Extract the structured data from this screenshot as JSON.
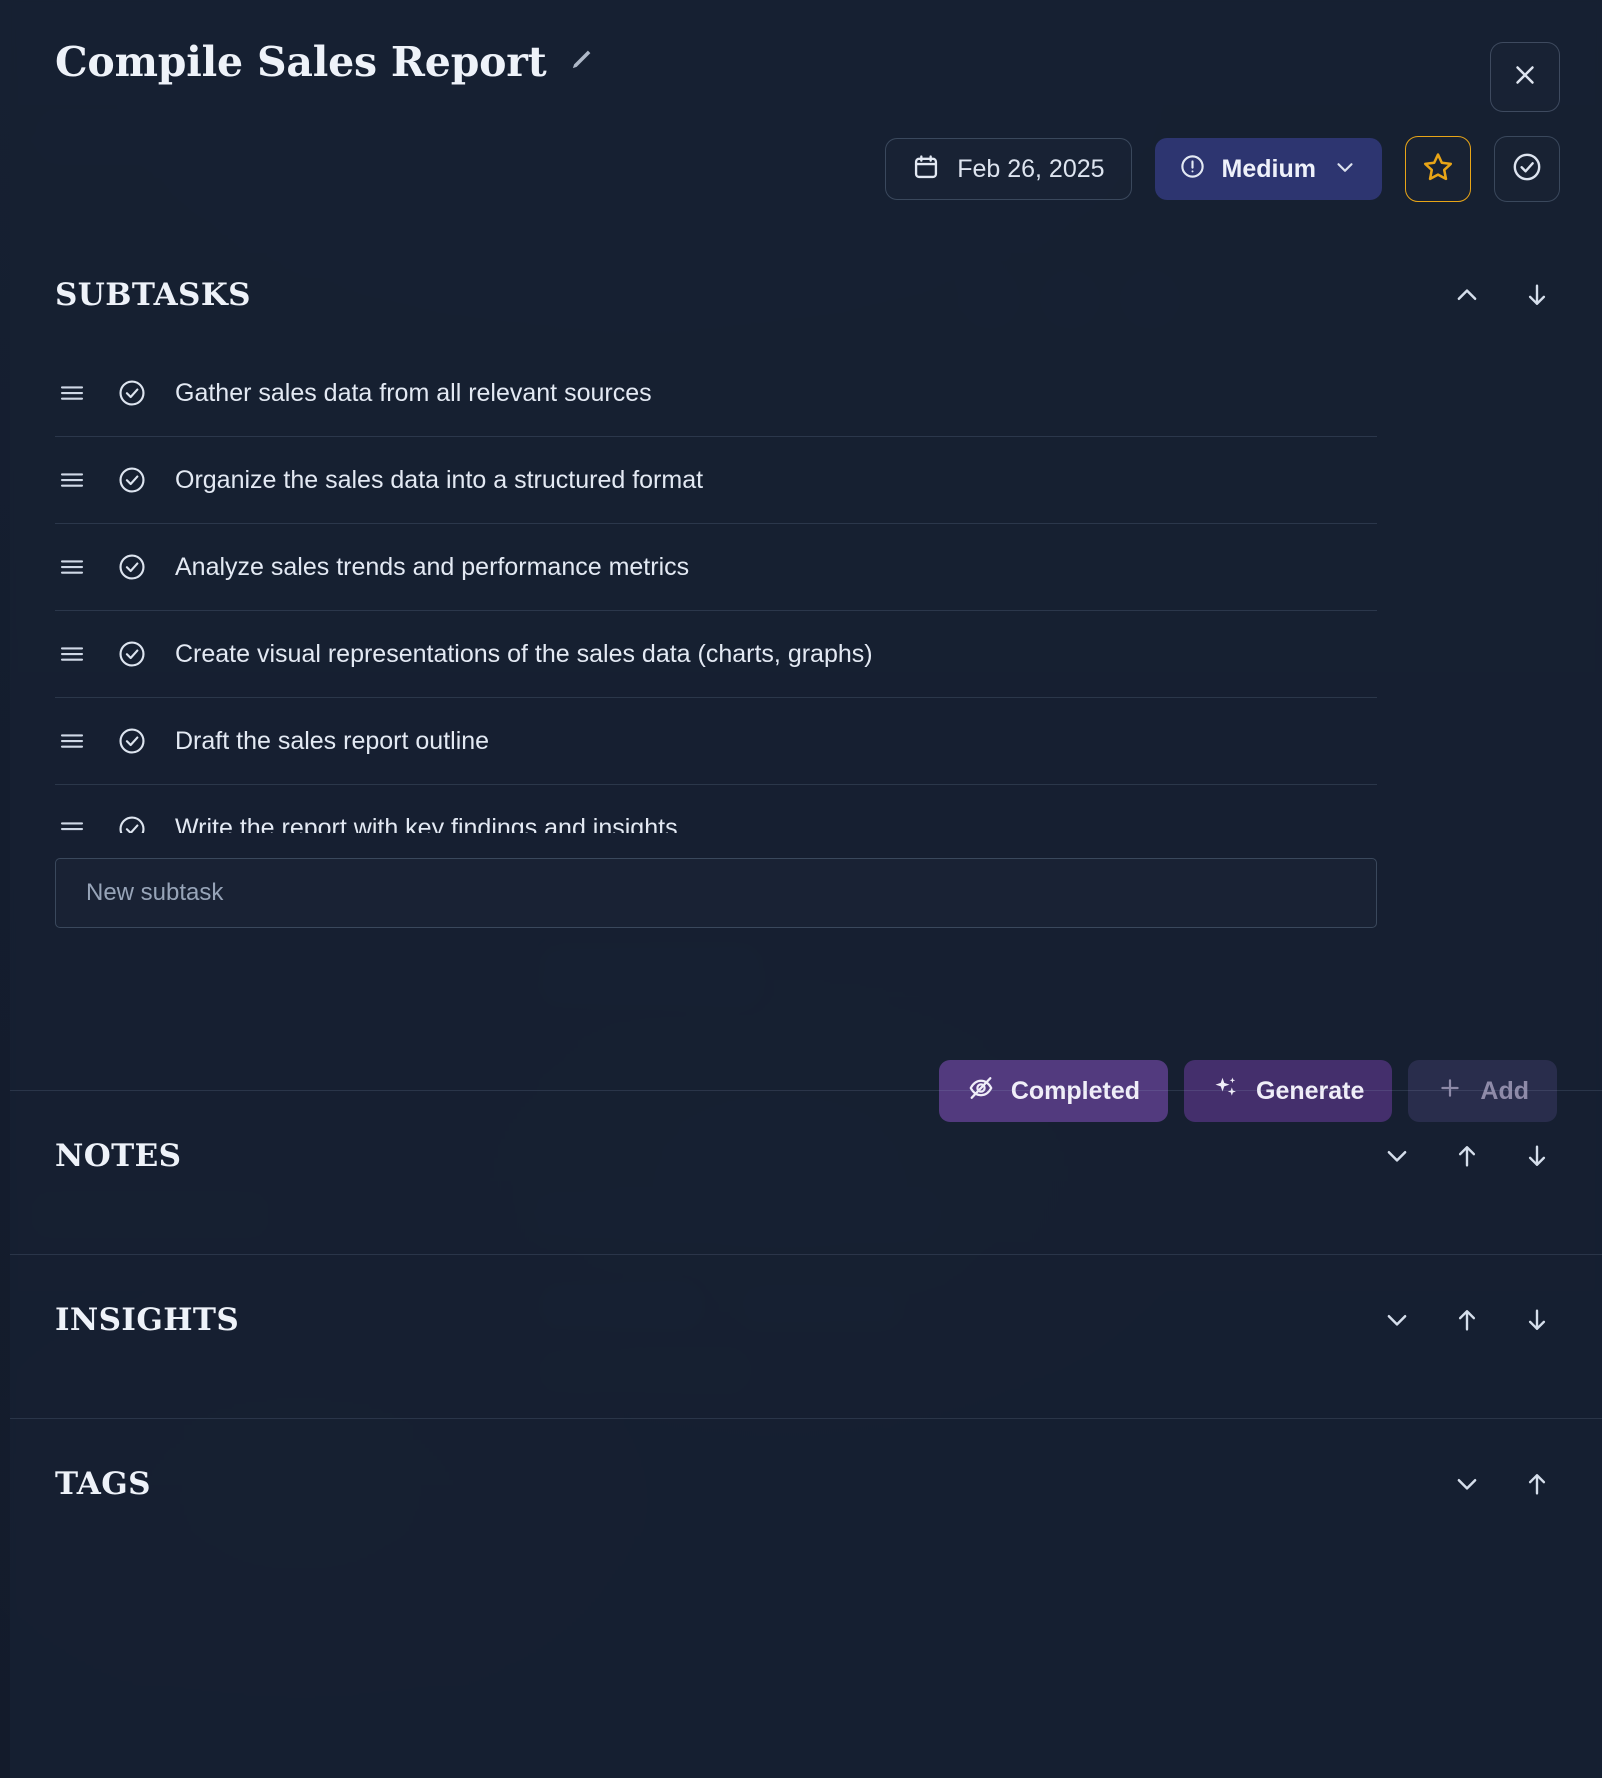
{
  "header": {
    "title": "Compile Sales Report",
    "edit_icon": "pencil-icon",
    "close_icon": "close-icon",
    "date": "Feb 26, 2025",
    "date_icon": "calendar-icon",
    "priority": "Medium",
    "priority_icon": "alert-circle-icon",
    "priority_chevron": "chevron-down-icon",
    "star_icon": "star-icon",
    "complete_icon": "check-circle-icon",
    "star_color": "#e8a517",
    "priority_bg": "#2d3570"
  },
  "subtasks": {
    "heading": "SUBTASKS",
    "controls": [
      "chevron-up-icon",
      "arrow-down-icon"
    ],
    "items": [
      {
        "text": "Gather sales data from all relevant sources",
        "handle": "drag-handle-icon",
        "status": "check-circle-icon"
      },
      {
        "text": "Organize the sales data into a structured format",
        "handle": "drag-handle-icon",
        "status": "check-circle-icon"
      },
      {
        "text": "Analyze sales trends and performance metrics",
        "handle": "drag-handle-icon",
        "status": "check-circle-icon"
      },
      {
        "text": "Create visual representations of the sales data (charts, graphs)",
        "handle": "drag-handle-icon",
        "status": "check-circle-icon"
      },
      {
        "text": "Draft the sales report outline",
        "handle": "drag-handle-icon",
        "status": "check-circle-icon"
      },
      {
        "text": "Write the report with key findings and insights",
        "handle": "drag-handle-icon",
        "status": "check-circle-icon"
      }
    ],
    "new_subtask_placeholder": "New subtask",
    "new_subtask_value": "",
    "buttons": {
      "completed": "Completed",
      "completed_icon": "eye-off-icon",
      "generate": "Generate",
      "generate_icon": "sparkles-icon",
      "add": "Add",
      "add_icon": "plus-icon"
    }
  },
  "notes": {
    "heading": "NOTES",
    "controls": [
      "chevron-down-icon",
      "arrow-up-icon",
      "arrow-down-icon"
    ]
  },
  "insights": {
    "heading": "INSIGHTS",
    "controls": [
      "chevron-down-icon",
      "arrow-up-icon",
      "arrow-down-icon"
    ]
  },
  "tags": {
    "heading": "TAGS",
    "controls": [
      "chevron-down-icon",
      "arrow-up-icon"
    ]
  }
}
